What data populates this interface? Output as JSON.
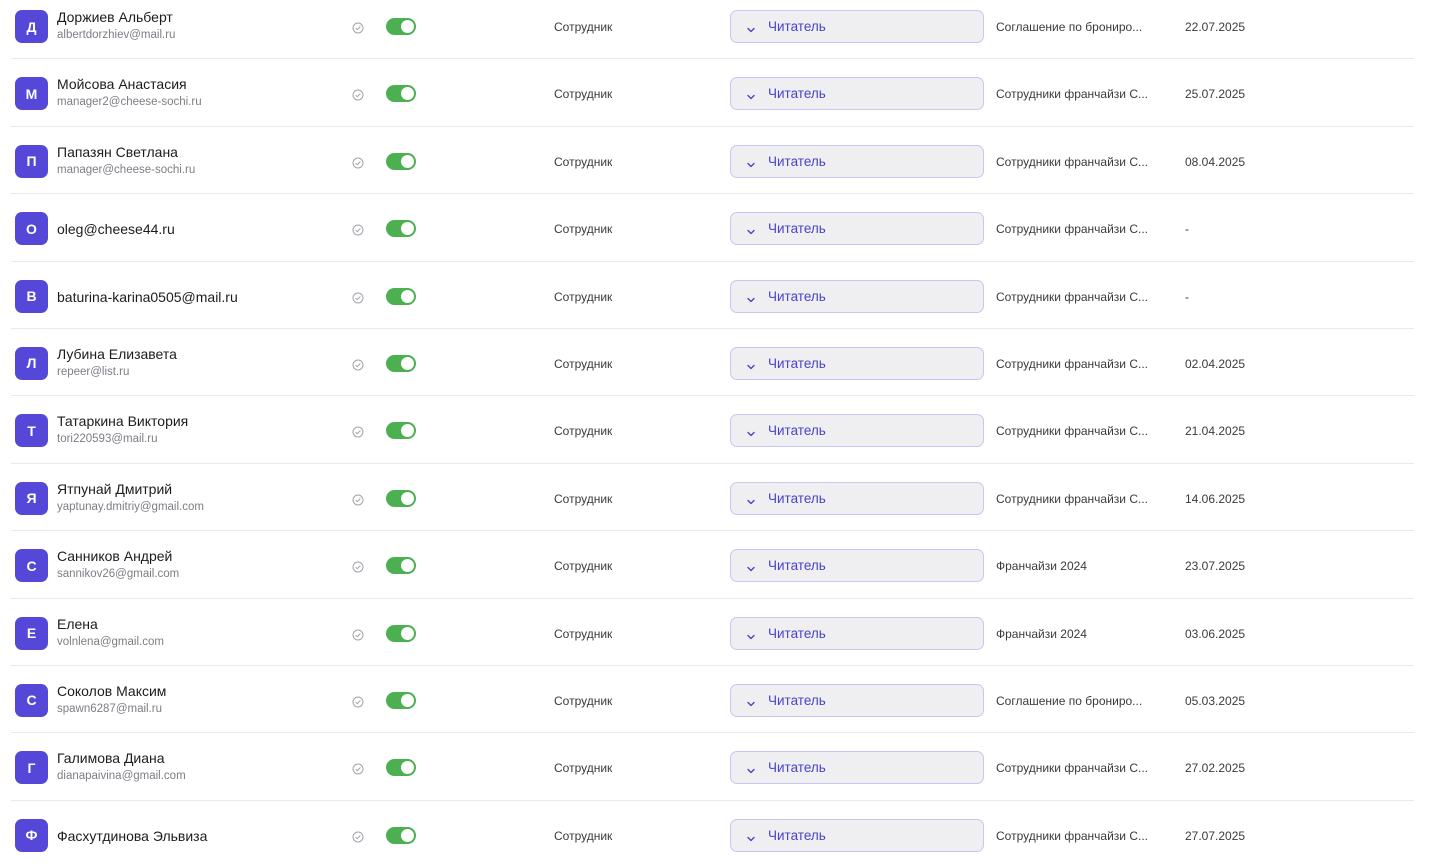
{
  "role_select_label": "Читатель",
  "colors": {
    "avatar": "#5548d9",
    "toggle_on": "#4caf50",
    "select_text": "#4a43c9",
    "select_border": "#c9c5f3"
  },
  "icons": {
    "status": "check-circle-icon",
    "select": "chevron-down-icon"
  },
  "rows": [
    {
      "initial": "Д",
      "name": "Доржиев Альберт",
      "email": "albertdorzhiev@mail.ru",
      "user_type": "Сотрудник",
      "role": "Читатель",
      "group": "Соглашение по брониро...",
      "date": "22.07.2025",
      "active": true
    },
    {
      "initial": "М",
      "name": "Мойсова Анастасия",
      "email": "manager2@cheese-sochi.ru",
      "user_type": "Сотрудник",
      "role": "Читатель",
      "group": "Сотрудники франчайзи С...",
      "date": "25.07.2025",
      "active": true
    },
    {
      "initial": "П",
      "name": "Папазян Светлана",
      "email": "manager@cheese-sochi.ru",
      "user_type": "Сотрудник",
      "role": "Читатель",
      "group": "Сотрудники франчайзи С...",
      "date": "08.04.2025",
      "active": true
    },
    {
      "initial": "О",
      "name": "oleg@cheese44.ru",
      "email": "",
      "user_type": "Сотрудник",
      "role": "Читатель",
      "group": "Сотрудники франчайзи С...",
      "date": "-",
      "active": true
    },
    {
      "initial": "В",
      "name": "baturina-karina0505@mail.ru",
      "email": "",
      "user_type": "Сотрудник",
      "role": "Читатель",
      "group": "Сотрудники франчайзи С...",
      "date": "-",
      "active": true
    },
    {
      "initial": "Л",
      "name": "Лубина Елизавета",
      "email": "repeer@list.ru",
      "user_type": "Сотрудник",
      "role": "Читатель",
      "group": "Сотрудники франчайзи С...",
      "date": "02.04.2025",
      "active": true
    },
    {
      "initial": "Т",
      "name": "Татаркина Виктория",
      "email": "tori220593@mail.ru",
      "user_type": "Сотрудник",
      "role": "Читатель",
      "group": "Сотрудники франчайзи С...",
      "date": "21.04.2025",
      "active": true
    },
    {
      "initial": "Я",
      "name": "Ятпунай Дмитрий",
      "email": "yaptunay.dmitriy@gmail.com",
      "user_type": "Сотрудник",
      "role": "Читатель",
      "group": "Сотрудники франчайзи С...",
      "date": "14.06.2025",
      "active": true
    },
    {
      "initial": "С",
      "name": "Санников Андрей",
      "email": "sannikov26@gmail.com",
      "user_type": "Сотрудник",
      "role": "Читатель",
      "group": "Франчайзи 2024",
      "date": "23.07.2025",
      "active": true
    },
    {
      "initial": "Е",
      "name": "Елена",
      "email": "volnlena@gmail.com",
      "user_type": "Сотрудник",
      "role": "Читатель",
      "group": "Франчайзи 2024",
      "date": "03.06.2025",
      "active": true
    },
    {
      "initial": "С",
      "name": "Соколов Максим",
      "email": "spawn6287@mail.ru",
      "user_type": "Сотрудник",
      "role": "Читатель",
      "group": "Соглашение по брониро...",
      "date": "05.03.2025",
      "active": true
    },
    {
      "initial": "Г",
      "name": "Галимова Диана",
      "email": "dianapaivina@gmail.com",
      "user_type": "Сотрудник",
      "role": "Читатель",
      "group": "Сотрудники франчайзи С...",
      "date": "27.02.2025",
      "active": true
    },
    {
      "initial": "Ф",
      "name": "Фасхутдинова Эльвиза",
      "email": "",
      "user_type": "Сотрудник",
      "role": "Читатель",
      "group": "Сотрудники франчайзи С...",
      "date": "27.07.2025",
      "active": true
    }
  ]
}
